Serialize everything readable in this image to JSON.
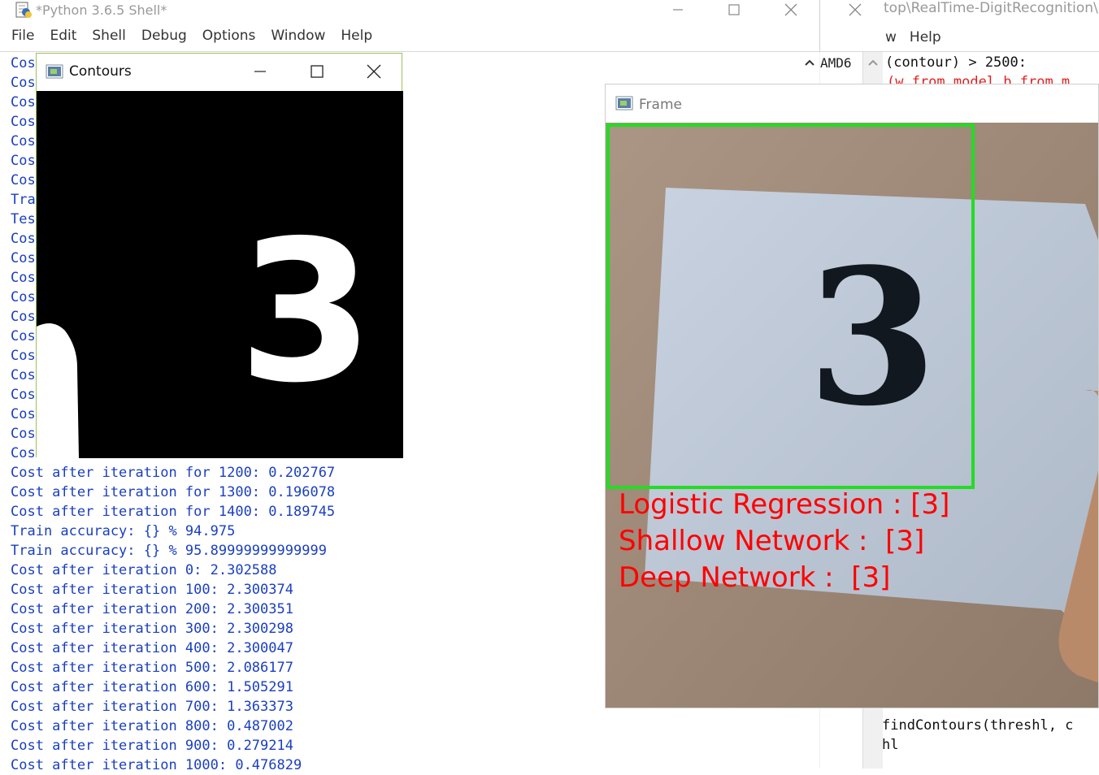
{
  "shell": {
    "title": "*Python 3.6.5 Shell*",
    "menu": [
      "File",
      "Edit",
      "Shell",
      "Debug",
      "Options",
      "Window",
      "Help"
    ],
    "left_fragments": [
      "Cos",
      "Cos",
      "Cos",
      "Cos",
      "Cos",
      "Cos",
      "Cos",
      "Tra",
      "Tes",
      "Cos",
      "Cos",
      "Cos",
      "Cos",
      "Cos",
      "Cos",
      "Cos",
      "Cos",
      "Cos",
      "Cos",
      "Cos",
      "Cos"
    ],
    "output_lines": [
      "Cost after iteration for 1200: 0.202767",
      "Cost after iteration for 1300: 0.196078",
      "Cost after iteration for 1400: 0.189745",
      "Train accuracy: {} % 94.975",
      "Train accuracy: {} % 95.89999999999999",
      "Cost after iteration 0: 2.302588",
      "Cost after iteration 100: 2.300374",
      "Cost after iteration 200: 2.300351",
      "Cost after iteration 300: 2.300298",
      "Cost after iteration 400: 2.300047",
      "Cost after iteration 500: 2.086177",
      "Cost after iteration 600: 1.505291",
      "Cost after iteration 700: 1.363373",
      "Cost after iteration 800: 0.487002",
      "Cost after iteration 900: 0.279214",
      "Cost after iteration 1000: 0.476829"
    ]
  },
  "editor": {
    "title": "top\\RealTime-DigitRecognition\\Di",
    "menu": [
      "w",
      "Help"
    ],
    "shell_fragment": "AMD6",
    "code_lines": [
      "(contour) > 2500:",
      "(w_from_model_b_from_m"
    ],
    "bottom_lines": [
      "findContours(threshl, c",
      "hl"
    ]
  },
  "contours_window": {
    "title": "Contours",
    "digit": "3"
  },
  "frame_window": {
    "title": "Frame",
    "digit": "3",
    "predictions": [
      "Logistic Regression : [3]",
      "Shallow Network :  [3]",
      "Deep Network :  [3]"
    ]
  },
  "colors": {
    "shell_text": "#1a3fbf",
    "prediction_red": "#ff0000",
    "roi_green": "#22dd22"
  },
  "icons": [
    "python-idle-icon",
    "minimize-icon",
    "maximize-icon",
    "close-icon",
    "opencv-window-icon",
    "scroll-up-icon"
  ]
}
